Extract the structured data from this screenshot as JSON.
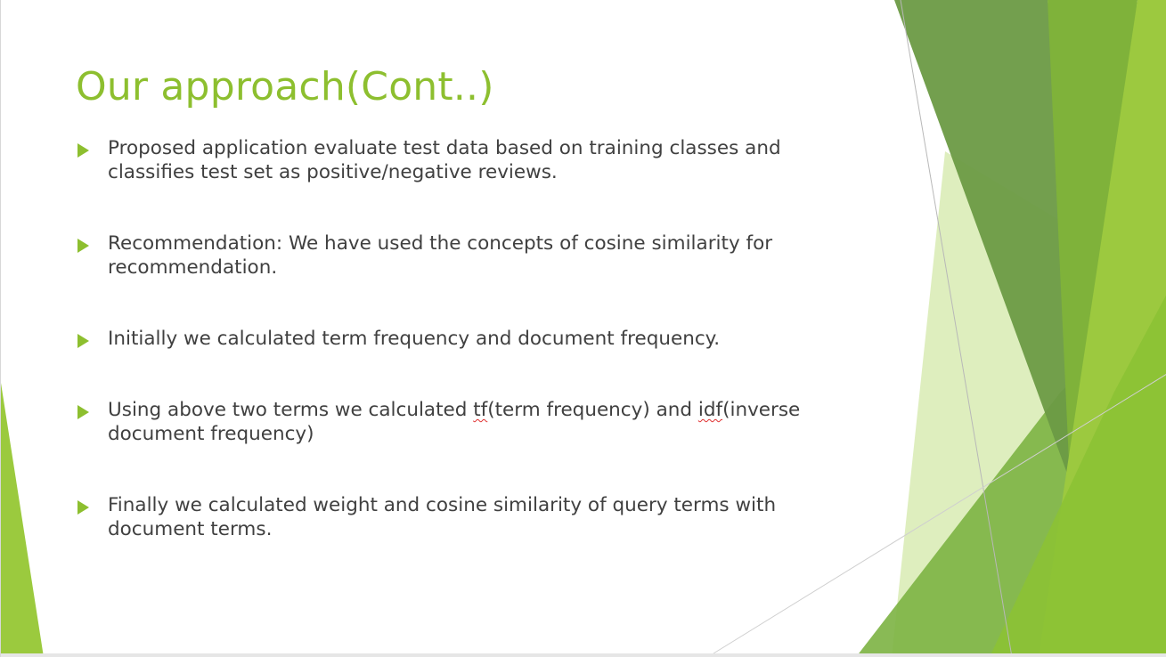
{
  "slide": {
    "title": "Our approach(Cont..)",
    "bullets": [
      {
        "text": "Proposed application evaluate test data based on training classes and classifies test set as positive/negative reviews."
      },
      {
        "text": "Recommendation: We have used the concepts of cosine similarity for recommendation."
      },
      {
        "text": "Initially we calculated term frequency and document frequency."
      },
      {
        "part1": "Using above two terms we calculated ",
        "misspelled1": "tf",
        "part2": "(term frequency) and ",
        "misspelled2": "idf",
        "part3": "(inverse document frequency)"
      },
      {
        "text": "Finally we calculated weight and cosine similarity of query terms with document terms."
      }
    ]
  },
  "colors": {
    "title": "#8dbf2f",
    "body_text": "#404040",
    "accent_light": "#9bca3e",
    "accent_dark": "#5f8f32",
    "accent_pale": "#d8ebb3",
    "spellcheck": "#e03030"
  },
  "icons": {
    "bullet": "triangle-bullet-icon"
  }
}
